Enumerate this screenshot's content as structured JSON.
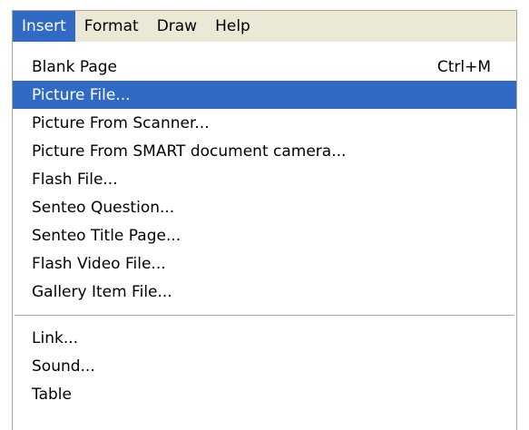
{
  "menubar": {
    "items": [
      {
        "label": "Insert",
        "active": true
      },
      {
        "label": "Format",
        "active": false
      },
      {
        "label": "Draw",
        "active": false
      },
      {
        "label": "Help",
        "active": false
      }
    ]
  },
  "menu": {
    "group1": [
      {
        "label": "Blank Page",
        "shortcut": "Ctrl+M",
        "highlighted": false
      },
      {
        "label": "Picture File...",
        "shortcut": "",
        "highlighted": true
      },
      {
        "label": "Picture From Scanner...",
        "shortcut": "",
        "highlighted": false
      },
      {
        "label": "Picture From SMART document camera...",
        "shortcut": "",
        "highlighted": false
      },
      {
        "label": "Flash File...",
        "shortcut": "",
        "highlighted": false
      },
      {
        "label": "Senteo Question...",
        "shortcut": "",
        "highlighted": false
      },
      {
        "label": "Senteo Title Page...",
        "shortcut": "",
        "highlighted": false
      },
      {
        "label": "Flash Video File...",
        "shortcut": "",
        "highlighted": false
      },
      {
        "label": "Gallery Item File...",
        "shortcut": "",
        "highlighted": false
      }
    ],
    "group2": [
      {
        "label": "Link...",
        "shortcut": "",
        "highlighted": false
      },
      {
        "label": "Sound...",
        "shortcut": "",
        "highlighted": false
      },
      {
        "label": "Table",
        "shortcut": "",
        "highlighted": false
      }
    ]
  },
  "colors": {
    "highlight": "#316ac5",
    "menubar_bg": "#ebe8d6",
    "border": "#aca899"
  }
}
